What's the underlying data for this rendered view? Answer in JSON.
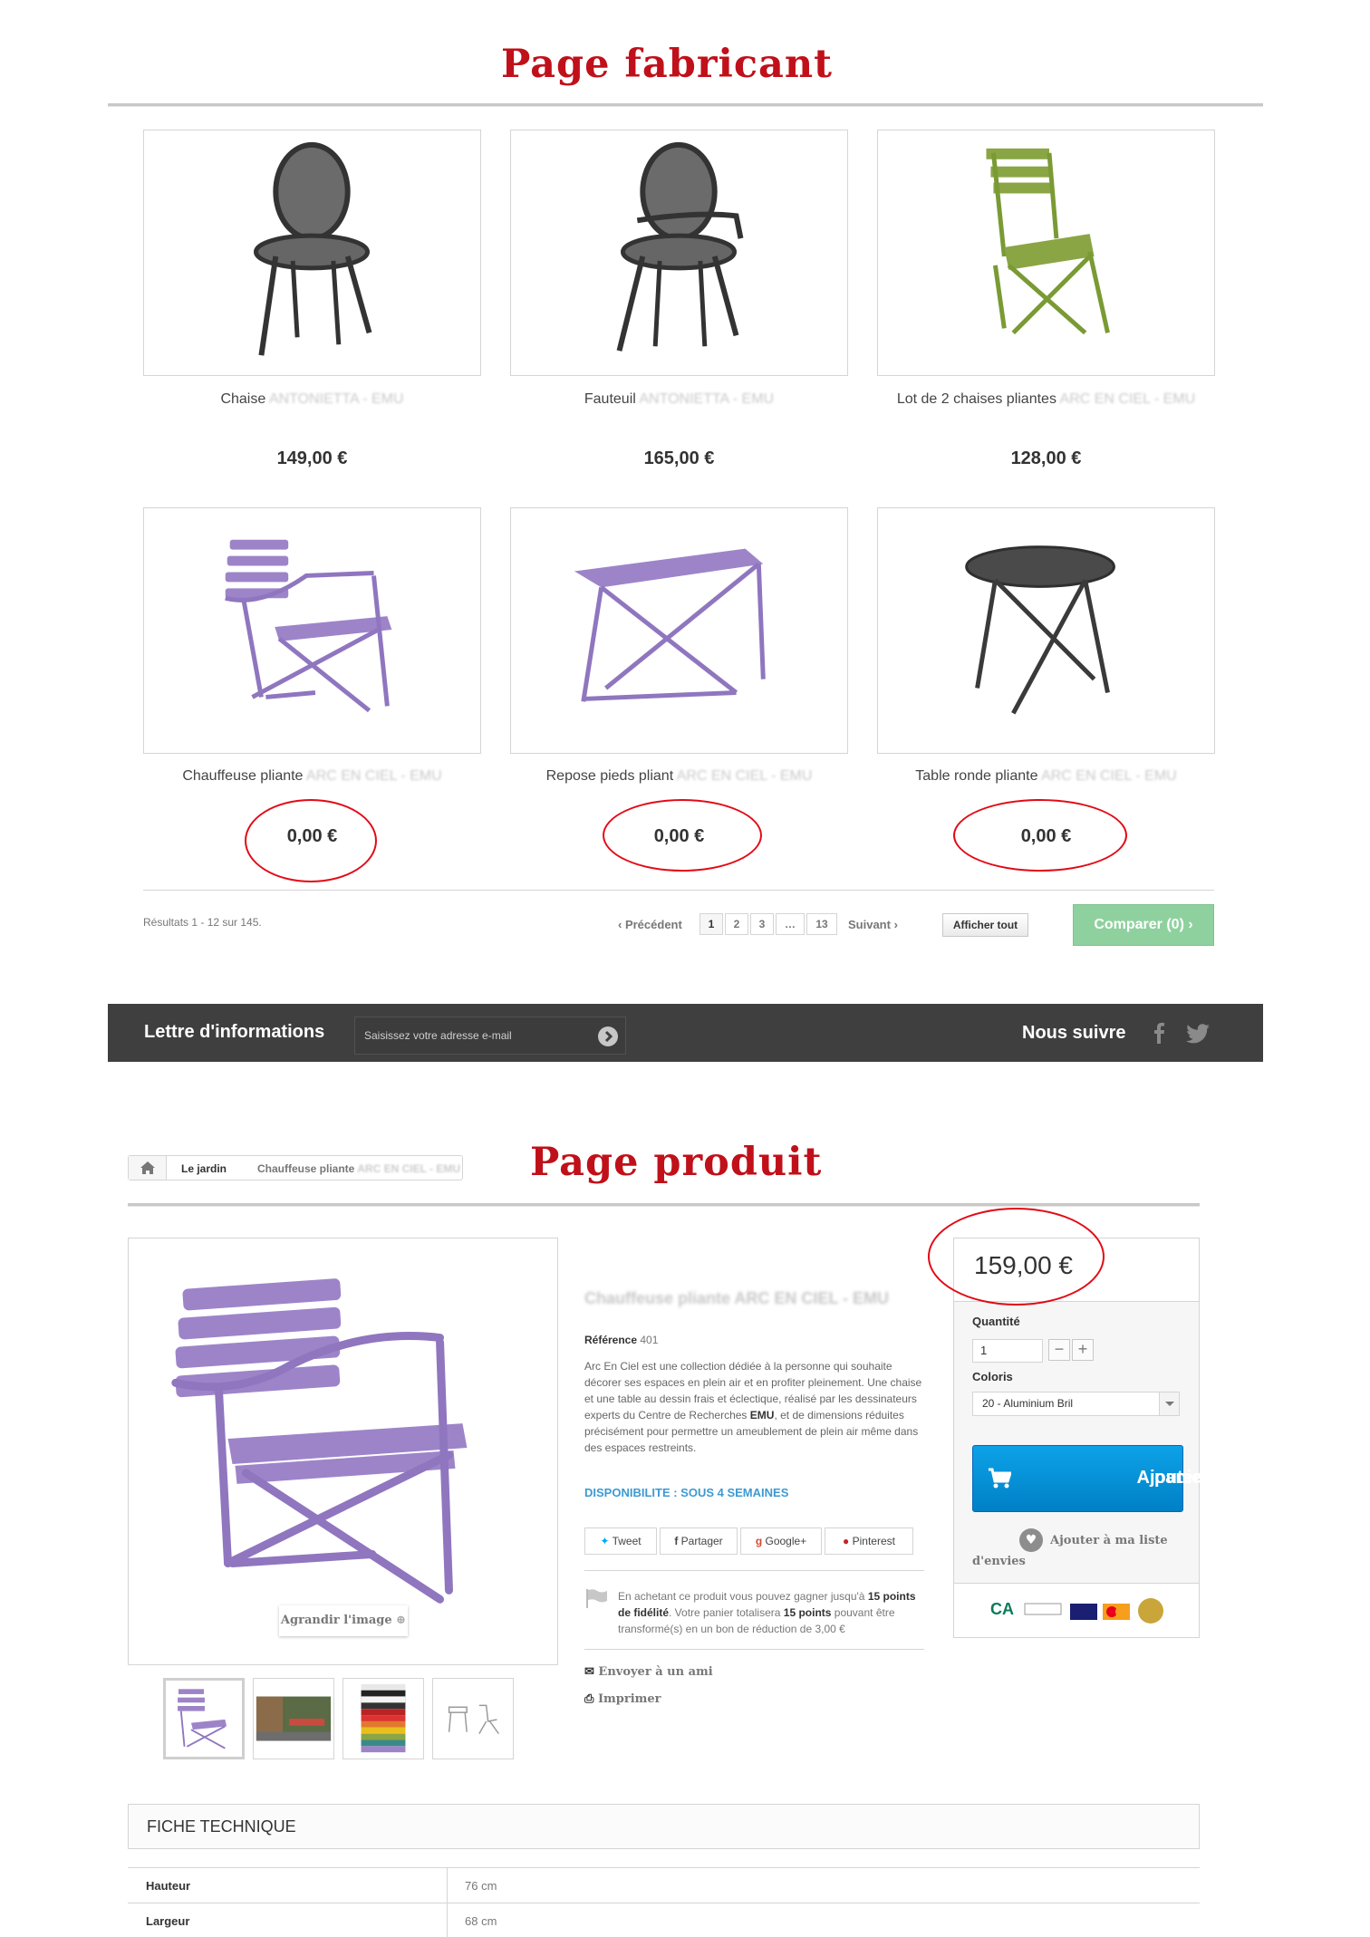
{
  "manufacturer_page": {
    "title": "Page fabricant",
    "products": [
      {
        "name": "Chaise",
        "name_suffix": "ANTONIETTA - EMU",
        "price": "149,00 €"
      },
      {
        "name": "Fauteuil",
        "name_suffix": "ANTONIETTA - EMU",
        "price": "165,00 €"
      },
      {
        "name": "Lot de 2 chaises pliantes",
        "name_suffix": "ARC EN CIEL - EMU",
        "price": "128,00 €"
      },
      {
        "name": "Chauffeuse pliante",
        "name_suffix": "ARC EN CIEL - EMU",
        "price": "0,00 €"
      },
      {
        "name": "Repose pieds pliant",
        "name_suffix": "ARC EN CIEL - EMU",
        "price": "0,00 €"
      },
      {
        "name": "Table ronde pliante",
        "name_suffix": "ARC EN CIEL - EMU",
        "price": "0,00 €"
      }
    ],
    "results": "Résultats 1 - 12 sur 145.",
    "pagination": {
      "prev": "Précédent",
      "pages": [
        "1",
        "2",
        "3",
        "…",
        "13"
      ],
      "next": "Suivant"
    },
    "show_all": "Afficher tout",
    "compare": "Comparer (0)"
  },
  "newsletter": {
    "title": "Lettre d'informations",
    "placeholder": "Saisissez votre adresse e-mail",
    "follow": "Nous suivre"
  },
  "product_page": {
    "title": "Page produit",
    "breadcrumb": [
      "Le jardin",
      "Chauffeuse pliante"
    ],
    "breadcrumb_suffix": "ARC EN CIEL - EMU",
    "product_title": "Chauffeuse pliante ARC EN CIEL - EMU",
    "zoom_label": "Agrandir l'image",
    "reference_label": "Référence",
    "reference_value": "401",
    "description_pre": "Arc En Ciel est une collection dédiée à la personne qui souhaite décorer ses espaces en plein air et en profiter pleinement. Une chaise et une table au dessin frais et éclectique, réalisé par les dessinateurs experts du Centre de Recherches ",
    "description_brand": "EMU",
    "description_post": ", et de dimensions réduites précisément pour permettre un ameublement de plein air même dans des espaces restreints.",
    "availability": "DISPONIBILITE : SOUS 4 SEMAINES",
    "share": {
      "tweet": "Tweet",
      "facebook": "Partager",
      "google": "Google+",
      "pinterest": "Pinterest"
    },
    "loyalty_pre": "En achetant ce produit vous pouvez gagner jusqu'à ",
    "loyalty_points": "15 points de fidélité",
    "loyalty_mid": ". Votre panier totalisera ",
    "loyalty_total": "15 points",
    "loyalty_post": " pouvant être transformé(s) en un bon de réduction de 3,00 €",
    "send_friend": "Envoyer à un ami",
    "print": "Imprimer",
    "price": "159,00 €",
    "quantity_label": "Quantité",
    "quantity_value": "1",
    "color_label": "Coloris",
    "color_value": "20 - Aluminium Bril",
    "add_to_cart_line1": "Ajouter au",
    "add_to_cart_line2": "panier",
    "wishlist": "Ajouter à ma liste d'envies",
    "tech_sheet": "FICHE TECHNIQUE",
    "specs": [
      {
        "key": "Hauteur",
        "value": "76 cm"
      },
      {
        "key": "Largeur",
        "value": "68 cm"
      }
    ],
    "swatch_codes": [
      "22",
      "23",
      "24",
      "25",
      "26",
      "27",
      "28",
      "29",
      "30",
      "31",
      "32"
    ]
  },
  "colors": {
    "accent_red": "#c0101a",
    "cart_blue": "#0a93da",
    "compare_green": "#8fd19e",
    "newsletter_bg": "#3f3f3f",
    "purple_chair": "#9d84c9"
  }
}
